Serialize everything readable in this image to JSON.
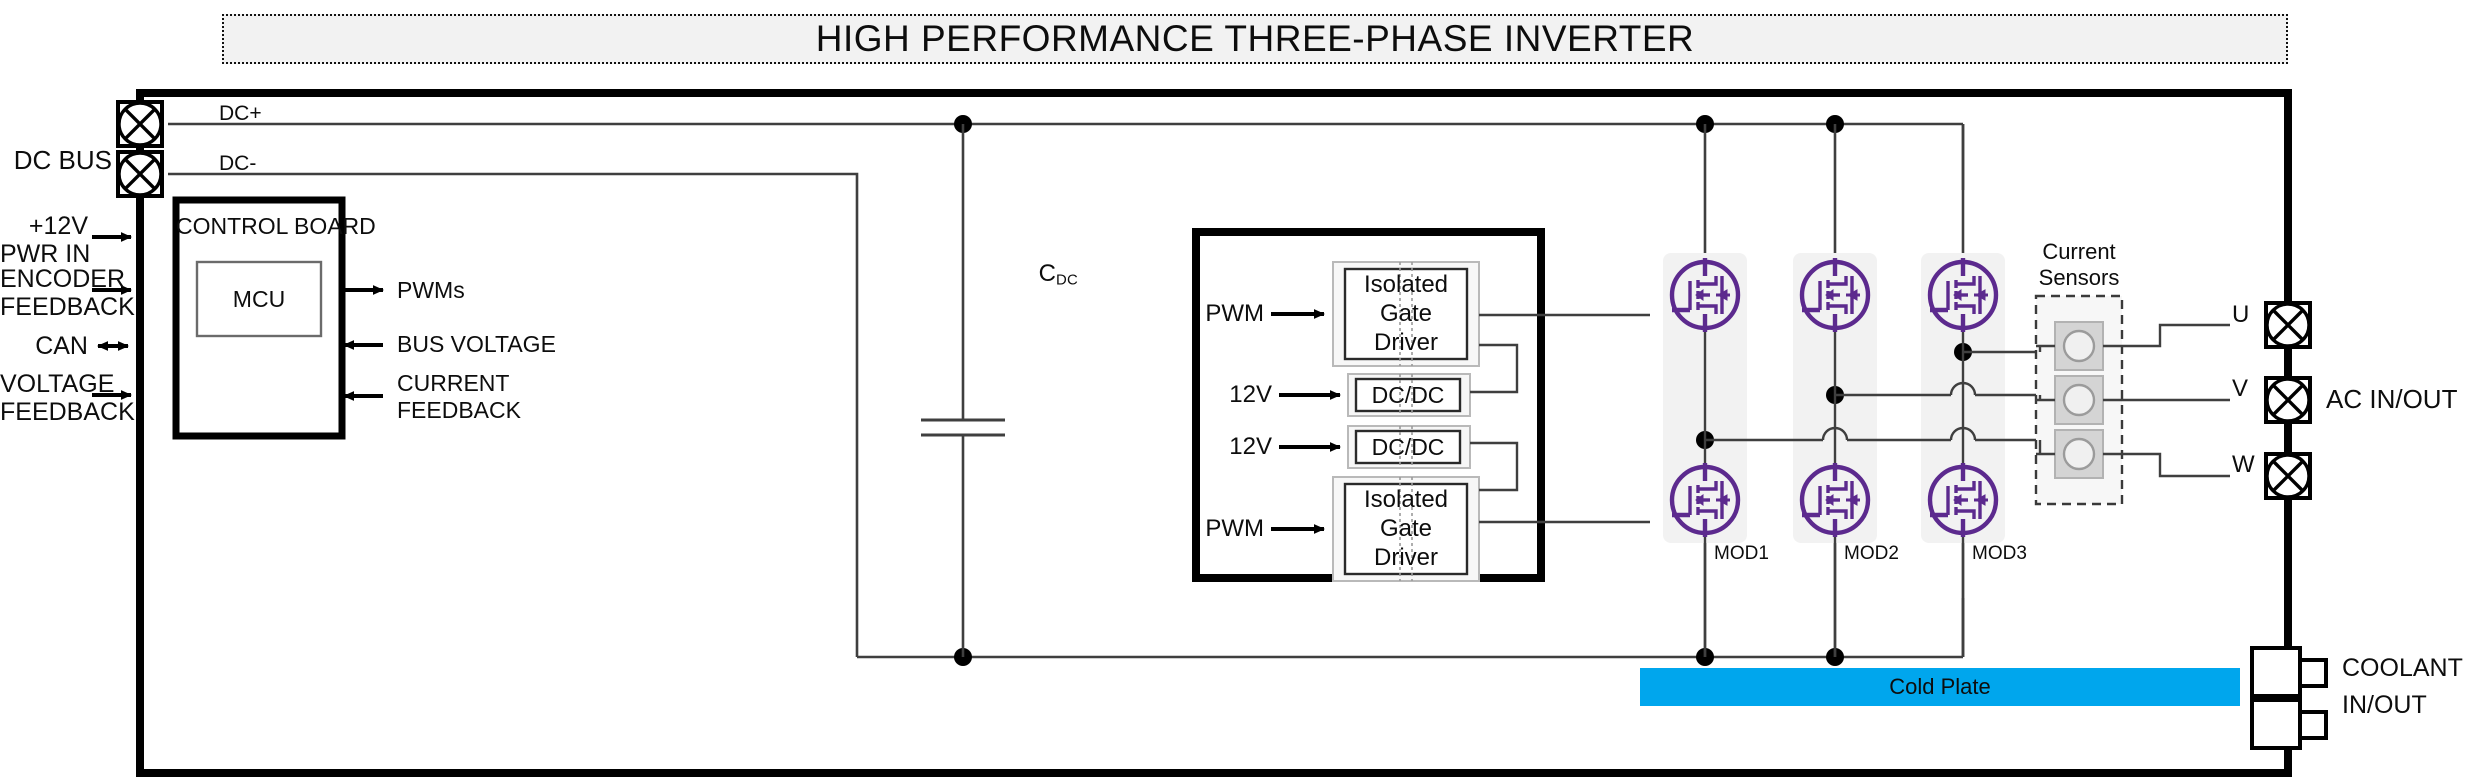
{
  "title": {
    "text": "HIGH PERFORMANCE THREE-PHASE INVERTER"
  },
  "colors": {
    "mosfet_purple": "#5c2a8e",
    "cold_plate_blue": "#00a6ed",
    "module_shade": "#f2f2f2",
    "banner_fill": "#f2f2f2",
    "wire": "#3f3f3f",
    "enclosure": "#000000"
  },
  "dc_bus": {
    "label": "DC BUS",
    "rail_plus": "DC+",
    "rail_minus": "DC-",
    "connector_count": 2,
    "connector_icon": "circle-x-terminal-icon"
  },
  "control_board": {
    "title": "CONTROL BOARD",
    "mcu": "MCU",
    "inputs": [
      {
        "label": "+12V\nPWR IN",
        "line1": "+12V",
        "line2": "PWR IN",
        "direction": "in"
      },
      {
        "label": "ENCODER\nFEEDBACK",
        "line1": "ENCODER",
        "line2": "FEEDBACK",
        "direction": "in"
      },
      {
        "label": "CAN",
        "line1": "CAN",
        "line2": "",
        "direction": "bidirectional"
      },
      {
        "label": "VOLTAGE\nFEEDBACK",
        "line1": "VOLTAGE",
        "line2": "FEEDBACK",
        "direction": "in"
      }
    ],
    "outputs": [
      {
        "label": "PWMs",
        "direction": "out"
      },
      {
        "label": "BUS VOLTAGE",
        "direction": "in"
      },
      {
        "label": "CURRENT\nFEEDBACK",
        "line1": "CURRENT",
        "line2": "FEEDBACK",
        "direction": "in"
      }
    ]
  },
  "dc_link": {
    "cap_label_main": "C",
    "cap_label_sub": "DC"
  },
  "gate_drive": {
    "blocks": [
      {
        "name": "Isolated Gate Driver",
        "l1": "Isolated",
        "l2": "Gate",
        "l3": "Driver",
        "input": "PWM"
      },
      {
        "name": "DC/DC",
        "l1": "DC/DC",
        "input": "12V"
      },
      {
        "name": "DC/DC",
        "l1": "DC/DC",
        "input": "12V"
      },
      {
        "name": "Isolated Gate Driver",
        "l1": "Isolated",
        "l2": "Gate",
        "l3": "Driver",
        "input": "PWM"
      }
    ]
  },
  "power_stage": {
    "modules": [
      {
        "label": "MOD1",
        "phase": "U"
      },
      {
        "label": "MOD2",
        "phase": "V"
      },
      {
        "label": "MOD3",
        "phase": "W"
      }
    ],
    "device_icon": "mosfet-with-body-diode-icon",
    "devices_per_module": 2
  },
  "current_sensors": {
    "l1": "Current",
    "l2": "Sensors",
    "count": 3,
    "icon": "current-sensor-ring-icon"
  },
  "ac_output": {
    "label": "AC IN/OUT",
    "phases": [
      "U",
      "V",
      "W"
    ],
    "connector_icon": "circle-x-terminal-icon"
  },
  "thermal": {
    "cold_plate": "Cold Plate",
    "coolant_l1": "COOLANT",
    "coolant_l2": "IN/OUT",
    "port_count": 2,
    "port_icon": "coolant-port-icon"
  }
}
